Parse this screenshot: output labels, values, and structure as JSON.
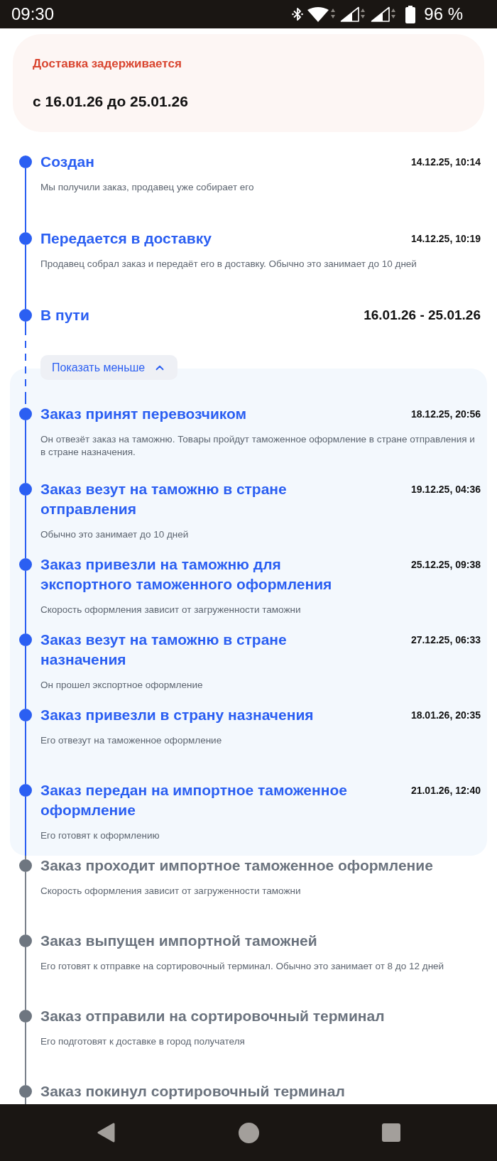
{
  "status_bar": {
    "time": "09:30",
    "battery": "96 %"
  },
  "delay_notice": {
    "title": "Доставка задерживается",
    "period": "с 16.01.26 до 25.01.26"
  },
  "timeline": {
    "main": [
      {
        "kind": "event",
        "title": "Создан",
        "date": "14.12.25, 10:14",
        "description": "Мы получили заказ, продавец уже собирает его",
        "done": true
      },
      {
        "kind": "event",
        "title": "Передается в доставку",
        "date": "14.12.25, 10:19",
        "description": "Продавец собрал заказ и передаёт его в доставку. Обычно это занимает до 10 дней",
        "done": true
      },
      {
        "kind": "estimate",
        "title": "В пути",
        "date": "16.01.26 - 25.01.26",
        "done": true
      }
    ],
    "toggle": {
      "label": "Показать меньше",
      "expanded": true
    },
    "details": [
      {
        "title": "Заказ принят перевозчиком",
        "date": "18.12.25, 20:56",
        "description": "Он отвезёт заказ на таможню. Товары пройдут таможенное оформление в стране отправления и в стране назначения.",
        "done": true
      },
      {
        "title": "Заказ везут на таможню в стране отправления",
        "date": "19.12.25, 04:36",
        "description": "Обычно это занимает до 10 дней",
        "done": true
      },
      {
        "title": "Заказ привезли на таможню для экспортного таможенного оформления",
        "date": "25.12.25, 09:38",
        "description": "Скорость оформления зависит от загруженности таможни",
        "done": true
      },
      {
        "title": "Заказ везут на таможню в стране назначения",
        "date": "27.12.25, 06:33",
        "description": "Он прошел экспортное оформление",
        "done": true
      },
      {
        "title": "Заказ привезли в страну назначения",
        "date": "18.01.26, 20:35",
        "description": "Его отвезут на таможенное оформление",
        "done": true
      },
      {
        "title": "Заказ передан на импортное таможенное оформление",
        "date": "21.01.26, 12:40",
        "description": "Его готовят к оформлению",
        "done": true
      }
    ],
    "upcoming": [
      {
        "title": "Заказ проходит импортное таможенное оформление",
        "description": "Скорость оформления зависит от загруженности таможни",
        "done": false
      },
      {
        "title": "Заказ выпущен импортной таможней",
        "description": "Его готовят к отправке на сортировочный терминал. Обычно это занимает от 8 до 12 дней",
        "done": false
      },
      {
        "title": "Заказ отправили на сортировочный терминал",
        "description": "Его подготовят к доставке в город получателя",
        "done": false
      },
      {
        "title": "Заказ покинул сортировочный терминал",
        "done": false
      }
    ]
  }
}
